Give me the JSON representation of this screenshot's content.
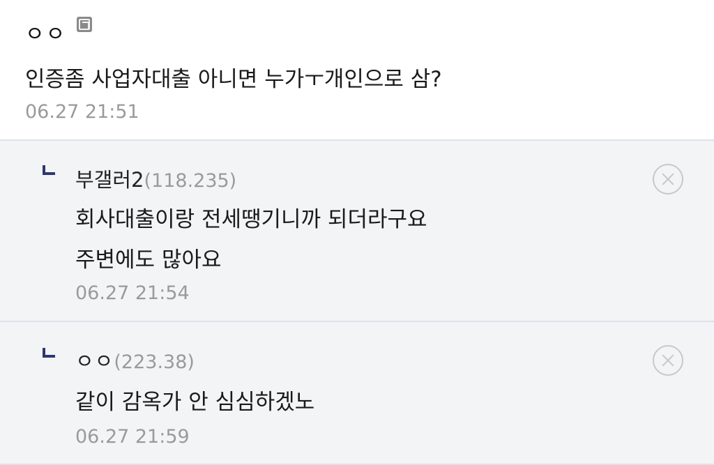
{
  "post": {
    "author": "ㅇㅇ",
    "author_icon": "fixed-nick-icon",
    "body": "인증좀 사업자대출 아니면 누가ㅜ개인으로 삼?",
    "time": "06.27 21:51"
  },
  "replies": [
    {
      "nick": "부갤러2",
      "ip": "(118.235)",
      "lines": [
        "회사대출이랑 전세땡기니까 되더라구요",
        "주변에도 많아요"
      ],
      "time": "06.27 21:54",
      "reply_icon": "reply-arrow-icon",
      "delete_icon": "delete-circle-icon"
    },
    {
      "nick": "ㅇㅇ",
      "ip": "(223.38)",
      "lines": [
        "같이 감옥가 안 심심하겠노"
      ],
      "time": "06.27 21:59",
      "reply_icon": "reply-arrow-icon",
      "delete_icon": "delete-circle-icon"
    }
  ],
  "colors": {
    "reply_bg": "#f3f4f6",
    "divider": "#dfe2ea",
    "meta_gray": "#9a9a9a",
    "reply_arrow": "#2f3770"
  }
}
